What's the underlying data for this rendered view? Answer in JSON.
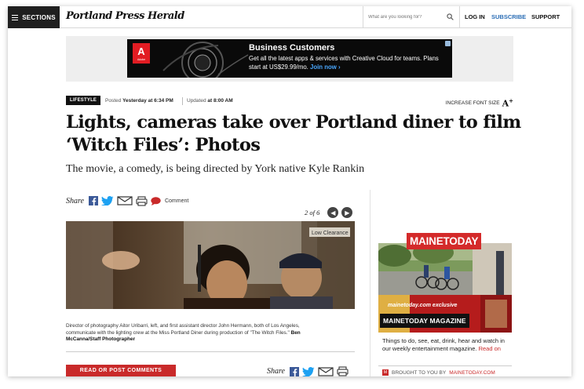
{
  "topbar": {
    "sections_label": "SECTIONS",
    "logo_text": "Portland Press Herald",
    "search_placeholder": "What are you looking for?",
    "login_label": "LOG IN",
    "subscribe_label": "SUBSCRIBE",
    "support_label": "SUPPORT"
  },
  "ad": {
    "logo_text": "A",
    "logo_sub": "Adobe",
    "title": "Business Customers",
    "body": "Get all the latest apps & services with Creative Cloud for teams. Plans start at US$29.99/mo.",
    "cta": "Join now ›"
  },
  "article": {
    "category": "LIFESTYLE",
    "posted_prefix": "Posted",
    "posted_time": "Yesterday at 6:34 PM",
    "updated_prefix": "Updated",
    "updated_time": "at 8:00 AM",
    "font_size_label": "INCREASE FONT SIZE",
    "font_size_icon": "A",
    "headline": "Lights, cameras take over Portland diner to film ‘Witch Files’: Photos",
    "subhead": "The movie, a comedy, is being directed by York native Kyle Rankin",
    "share_label": "Share",
    "comment_label": "Comment",
    "gallery_position": "2 of 6",
    "caption": "Director of photography Aitor Uribarri, left, and first assistant director John Hermann, both of Los Angeles, communicate with the lighting crew at the Miss Portland Diner during production of \"The Witch Files.\"",
    "caption_credit": "Ben McCanna/Staff Photographer",
    "photo_sign": "Low Clearance",
    "comments_button": "READ OR POST COMMENTS",
    "share_label_2": "Share"
  },
  "sidebar": {
    "logo": "MAINETODAY",
    "exclusive": "mainetoday.com exclusive",
    "magazine": "MAINETODAY MAGAZINE",
    "description": "Things to do, see, eat, drink, hear and watch in our weekly entertainment magazine.",
    "read_on": "Read on",
    "brought_by": "BROUGHT TO YOU BY",
    "brought_link": "MAINETODAY.COM"
  },
  "colors": {
    "accent_red": "#c92a2a",
    "link_blue": "#2a6db5",
    "facebook": "#3b5998",
    "twitter": "#1da1f2"
  },
  "icons": [
    "hamburger-icon",
    "search-icon",
    "font-size-icon",
    "facebook-icon",
    "twitter-icon",
    "email-icon",
    "print-icon",
    "comment-icon",
    "prev-arrow-icon",
    "next-arrow-icon"
  ]
}
